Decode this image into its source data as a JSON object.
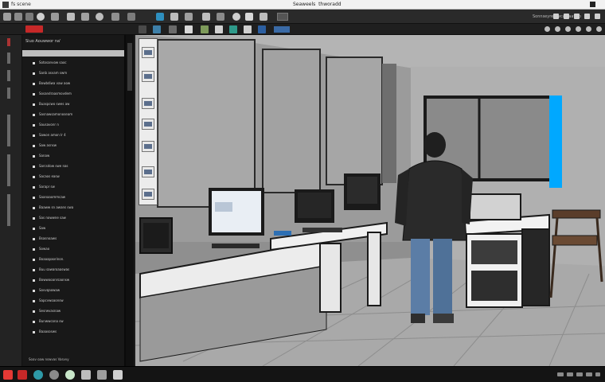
{
  "window": {
    "app_title": "fs scene",
    "document_title": "Seaweels  thworadd"
  },
  "toolbar": {
    "project_label": "Sonnseyrea wcanlaatolo"
  },
  "outliner": {
    "header": "Siuo Aouwwor na'",
    "items": [
      "Sotosanvow saoc",
      "Sanb asvam swm",
      "Bowbdiwa vaw aow",
      "Sosandraasmovdem",
      "Buaspcwo swes aw",
      "Sasnawsamonoseam",
      "Sausavonr n",
      "Sawon amon lr 4",
      "Saw asnsw",
      "Sanaw",
      "Sarcsdow swe nas",
      "Sacaos easw",
      "Sarapr sw",
      "Saanaaommcaw",
      "Baaww sn awans swa",
      "Sas nowwne saw",
      "Saw",
      "Bsasnoaws",
      "Sowao",
      "Boaaapaorinon.",
      "Buu sawaroaaswas",
      "Bowwooanrsaonsw",
      "Sovvqaowaw",
      "Sapcvwoaonsw",
      "Sesrwvasnaw",
      "Bunwwcona sw",
      "Baaasosws"
    ],
    "footer": "Soav oaw nswvas Vasvvy"
  },
  "colors": {
    "accent_record": "#c62828",
    "accent_blue": "#3a6aa6",
    "viewport_highlight": "#00a8ff"
  },
  "icons": {
    "titlebar_logo": "app-logo-icon",
    "titlebar_close": "close-icon",
    "taskbar_start": "start-icon",
    "taskbar_browser": "browser-icon",
    "taskbar_app": "app-icon"
  }
}
